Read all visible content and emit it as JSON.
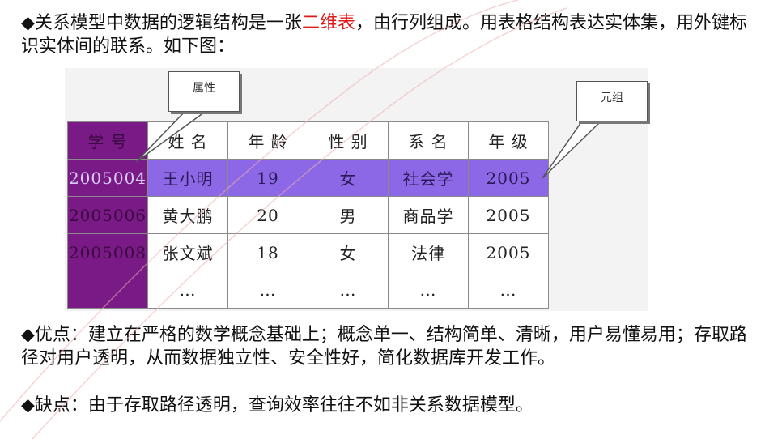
{
  "intro": {
    "bullet": "◆",
    "text_before": "关系模型中数据的逻辑结构是一张",
    "highlight": "二维表",
    "text_after": "，由行列组成。用表格结构表达实体集，用外键标识实体间的联系。如下图："
  },
  "figure": {
    "callout_attribute": "属性",
    "callout_tuple": "元组",
    "table": {
      "headers": [
        "学 号",
        "姓 名",
        "年 龄",
        "性 别",
        "系 名",
        "年 级"
      ],
      "rows": [
        [
          "2005004",
          "王小明",
          "19",
          "女",
          "社会学",
          "2005"
        ],
        [
          "2005006",
          "黄大鹏",
          "20",
          "男",
          "商品学",
          "2005"
        ],
        [
          "2005008",
          "张文斌",
          "18",
          "女",
          "法律",
          "2005"
        ],
        [
          "",
          "…",
          "…",
          "…",
          "…",
          "…"
        ]
      ]
    }
  },
  "pros": {
    "bullet": "◆",
    "text": "优点：建立在严格的数学概念基础上；概念单一、结构简单、清晰，用户易懂易用；存取路径对用户透明，从而数据独立性、安全性好，简化数据库开发工作。"
  },
  "cons": {
    "bullet": "◆",
    "text": "缺点：由于存取路径透明，查询效率往往不如非关系数据模型。"
  },
  "colors": {
    "highlight_text": "#e01818",
    "key_column": "#7a1a86",
    "highlighted_row": "#8c68e6"
  }
}
